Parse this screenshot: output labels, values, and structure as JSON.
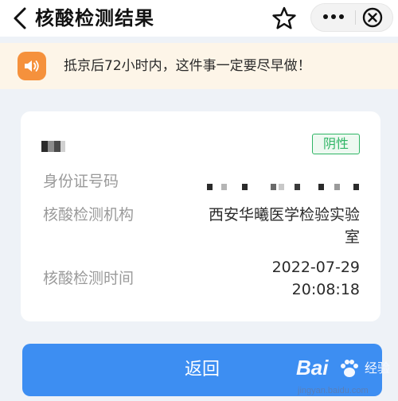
{
  "header": {
    "title": "核酸检测结果"
  },
  "notice": {
    "text": "抵京后72小时内，这件事一定要尽早做！"
  },
  "result": {
    "status_badge": "阴性",
    "rows": [
      {
        "label": "身份证号码",
        "value": ""
      },
      {
        "label": "核酸检测机构",
        "value_line1": "西安华曦医学检验实验",
        "value_line2": "室"
      },
      {
        "label": "核酸检测时间",
        "value_line1": "2022-07-29",
        "value_line2": "20:08:18"
      }
    ]
  },
  "footer": {
    "return_label": "返回"
  },
  "watermark": {
    "logo": "Bai",
    "text": "经验",
    "url": "jingyan.baidu.com"
  },
  "colors": {
    "accent_blue": "#3d8ef2",
    "negative_green": "#2fb565",
    "notice_bg": "#fdf5e8",
    "speaker_orange": "#f5913c"
  },
  "icons": {
    "back": "back-chevron-icon",
    "favorite": "star-icon",
    "more": "more-dots-icon",
    "close": "close-circle-icon",
    "notice": "speaker-icon"
  }
}
